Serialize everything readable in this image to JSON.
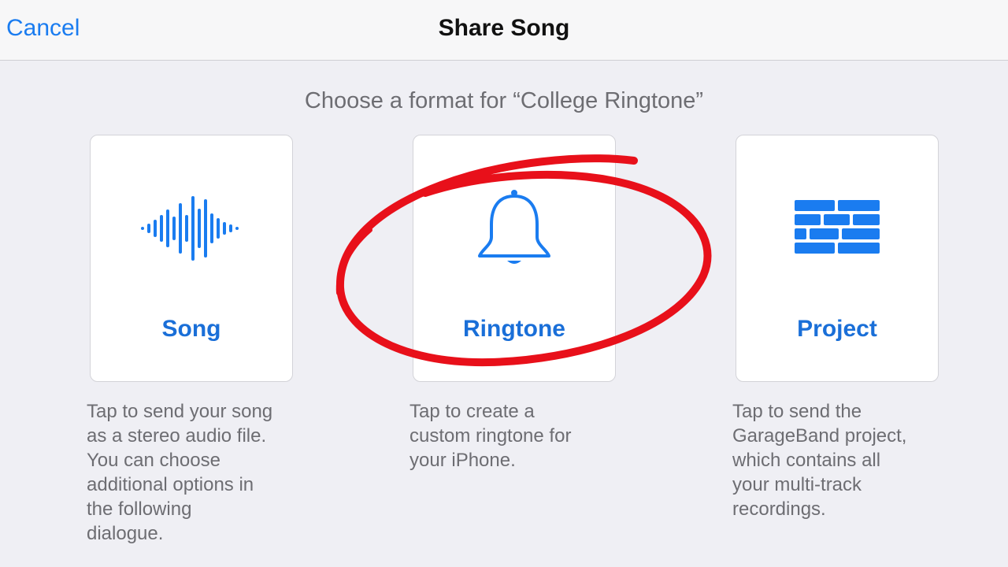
{
  "navbar": {
    "cancel_label": "Cancel",
    "title": "Share Song"
  },
  "subtitle": "Choose a format for “College Ringtone”",
  "options": [
    {
      "label": "Song",
      "icon": "waveform-icon",
      "description": "Tap to send your song\nas a stereo audio file.\nYou can choose\nadditional options in\nthe following\ndialogue."
    },
    {
      "label": "Ringtone",
      "icon": "bell-icon",
      "description": "Tap to create a\ncustom ringtone for\nyour iPhone."
    },
    {
      "label": "Project",
      "icon": "bricks-icon",
      "description": "Tap to send the\nGarageBand project,\nwhich contains all\nyour multi-track\nrecordings."
    }
  ],
  "colors": {
    "accent": "#1a7cf0",
    "background": "#efeff4",
    "annotation": "#e8101a"
  }
}
